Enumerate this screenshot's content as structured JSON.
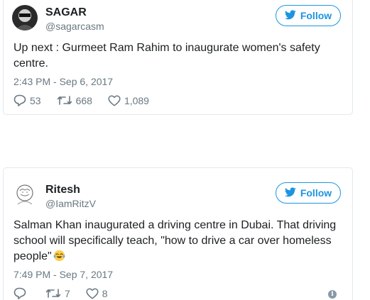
{
  "tweets": [
    {
      "author_name": "SAGAR",
      "author_handle": "@sagarcasm",
      "follow_label": "Follow",
      "text": "Up next : Gurmeet Ram Rahim to inaugurate women's safety centre.",
      "timestamp": "2:43 PM - Sep 6, 2017",
      "replies": "53",
      "retweets": "668",
      "likes": "1,089"
    },
    {
      "author_name": "Ritesh",
      "author_handle": "@IamRitzV",
      "follow_label": "Follow",
      "text": "Salman Khan inaugurated a driving centre in Dubai. That driving school will specifically teach, \"how to drive a car over homeless people\"",
      "timestamp": "7:49 PM - Sep 7, 2017",
      "replies": "",
      "retweets": "7",
      "likes": "8"
    }
  ],
  "colors": {
    "accent": "#1b95e0",
    "secondary_text": "#697882",
    "border": "#e1e8ed"
  },
  "icons": [
    "reply-icon",
    "retweet-icon",
    "like-icon",
    "twitter-bird-icon",
    "info-icon",
    "tears-of-joy-emoji"
  ]
}
